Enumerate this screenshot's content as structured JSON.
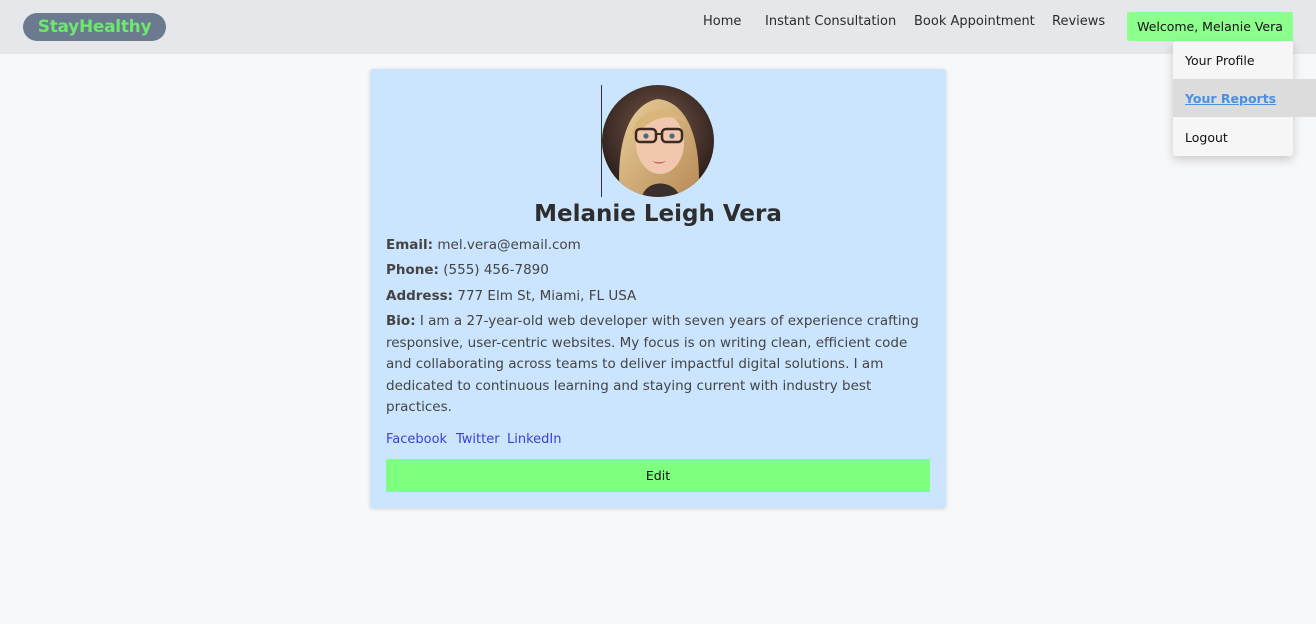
{
  "navbar": {
    "logo": "StayHealthy",
    "links": [
      "Home",
      "Instant Consultation",
      "Book Appointment",
      "Reviews"
    ],
    "welcome": "Welcome, Melanie Vera"
  },
  "dropdown": {
    "items": [
      "Your Profile",
      "Your Reports",
      "Logout"
    ]
  },
  "profile": {
    "name": "Melanie Leigh Vera",
    "email_label": "Email:",
    "email": "mel.vera@email.com",
    "phone_label": "Phone:",
    "phone": "(555) 456-7890",
    "address_label": "Address:",
    "address": "777 Elm St, Miami, FL USA",
    "bio_label": "Bio:",
    "bio": "I am a 27-year-old web developer with seven years of experience crafting responsive, user-centric websites. My focus is on writing clean, efficient code and collaborating across teams to deliver impactful digital solutions. I am dedicated to continuous learning and staying current with industry best practices.",
    "social": [
      "Facebook",
      "Twitter",
      "LinkedIn"
    ],
    "edit_label": "Edit"
  },
  "colors": {
    "logo_bg": "#6b7a8f",
    "logo_text": "#6ee76e",
    "accent_green": "#7fff7f",
    "card_bg": "#cce5fe",
    "link_blue": "#3f3fd0"
  }
}
